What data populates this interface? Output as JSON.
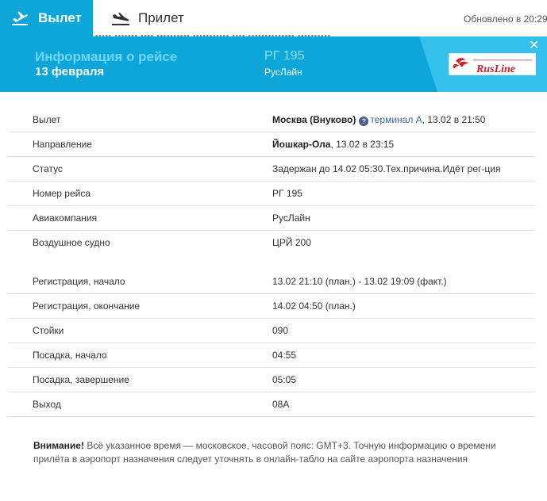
{
  "tabs": {
    "departure": {
      "label": "Вылет",
      "icon": "plane-takeoff-icon"
    },
    "arrival": {
      "label": "Прилет",
      "icon": "plane-landing-icon"
    }
  },
  "updated": "Обновлено в 20:29",
  "banner": {
    "title": "Информация о рейсе",
    "date": "13 февраля",
    "flight": "РГ 195",
    "airline": "РусЛайн",
    "logo_text": "RusLine",
    "close_icon": "close-icon"
  },
  "info": {
    "departure": {
      "label": "Вылет",
      "airport": "Москва (Внуково)",
      "help_icon": "?",
      "terminal": "терминал А",
      "time": ", 13.02 в 21:50"
    },
    "destination": {
      "label": "Направление",
      "city": "Йошкар-Ола",
      "time": ", 13.02 в 23:15"
    },
    "status": {
      "label": "Статус",
      "value": "Задержан до 14.02 05:30.Тех.причина.Идёт рег-ция"
    },
    "flight_number": {
      "label": "Номер рейса",
      "value": "РГ 195"
    },
    "airline": {
      "label": "Авиакомпания",
      "value": "РусЛайн"
    },
    "aircraft": {
      "label": "Воздушное судно",
      "value": "ЦРЙ 200"
    },
    "checkin_start": {
      "label": "Регистрация, начало",
      "value": "13.02 21:10 (план.) - 13.02 19:09 (факт.)"
    },
    "checkin_end": {
      "label": "Регистрация, окончание",
      "value": "14.02 04:50 (план.)"
    },
    "counters": {
      "label": "Стойки",
      "value": "090"
    },
    "boarding_start": {
      "label": "Посадка, начало",
      "value": "04:55"
    },
    "boarding_end": {
      "label": "Посадка, завершение",
      "value": "05:05"
    },
    "gate": {
      "label": "Выход",
      "value": "08А"
    }
  },
  "notice": {
    "strong": "Внимание!",
    "text": " Всё указанное время — московское, часовой пояс: GMT+3. Точную информацию о времени прилёта в аэропорт назначения следует уточнять в онлайн-табло на сайте аэропорта назначения"
  },
  "colors": {
    "brand": "#0ea6d9",
    "brand_light": "#35c0ee",
    "link": "#3a6aa0",
    "logo_red": "#d0202a"
  }
}
